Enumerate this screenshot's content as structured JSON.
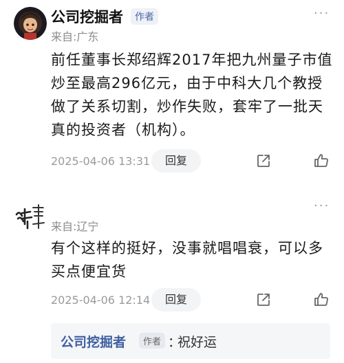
{
  "comments": [
    {
      "username": "公司挖掘者",
      "author_tag": "作者",
      "more": "···",
      "location": "来自:广东",
      "body": "前任董事长郑绍辉2017年把九州量子市值炒至最高296亿元，由于中科大几个教授做了关系切割，炒作失败，套牢了一批天真的投资者（机构）。",
      "timestamp": "2025-04-06 13:31",
      "reply_label": "回复"
    },
    {
      "username": "",
      "more": "···",
      "location": "来自:辽宁",
      "body": "有个这样的挺好，没事就唱唱衰，可以多买点便宜货",
      "timestamp": "2025-04-06 12:14",
      "reply_label": "回复",
      "replies": [
        {
          "username": "公司挖掘者",
          "author_tag": "作者",
          "colon": "：",
          "text": "祝好运"
        }
      ]
    }
  ],
  "colors": {
    "accent": "#3f5fa0",
    "tag_bg": "#eef1f6"
  }
}
